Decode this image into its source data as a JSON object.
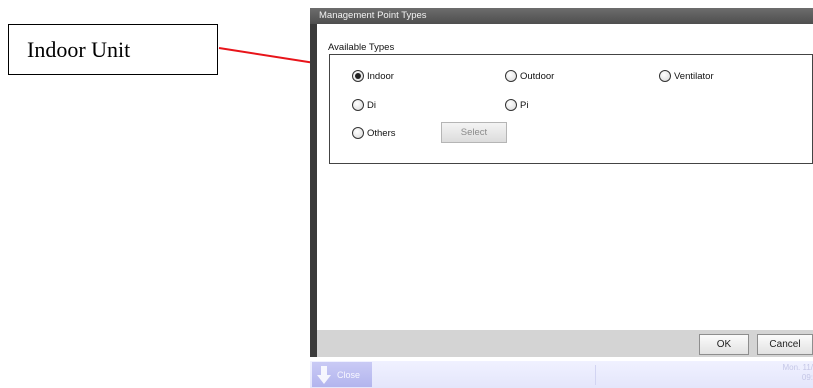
{
  "annotation": {
    "label": "Indoor Unit",
    "arrow_color": "#e8141a"
  },
  "dialog": {
    "title": "Management Point Types",
    "section_label": "Available Types",
    "options": [
      {
        "label": "Indoor",
        "selected": true
      },
      {
        "label": "Outdoor",
        "selected": false
      },
      {
        "label": "Ventilator",
        "selected": false
      },
      {
        "label": "Di",
        "selected": false
      },
      {
        "label": "Pi",
        "selected": false
      },
      {
        "label": "Others",
        "selected": false
      }
    ],
    "select_button": {
      "label": "Select",
      "enabled": false
    },
    "ok_label": "OK",
    "cancel_label": "Cancel"
  },
  "taskbar": {
    "close_label": "Close",
    "date_text": "Mon. 11/",
    "time_text": "09:"
  },
  "colors": {
    "dialog_frame": "#3a3a3a",
    "titlebar": "#5c5c5c",
    "action_bar": "#d4d4d4",
    "taskbar": "#e8eafc",
    "taskbar_close": "#bcbdf0"
  }
}
